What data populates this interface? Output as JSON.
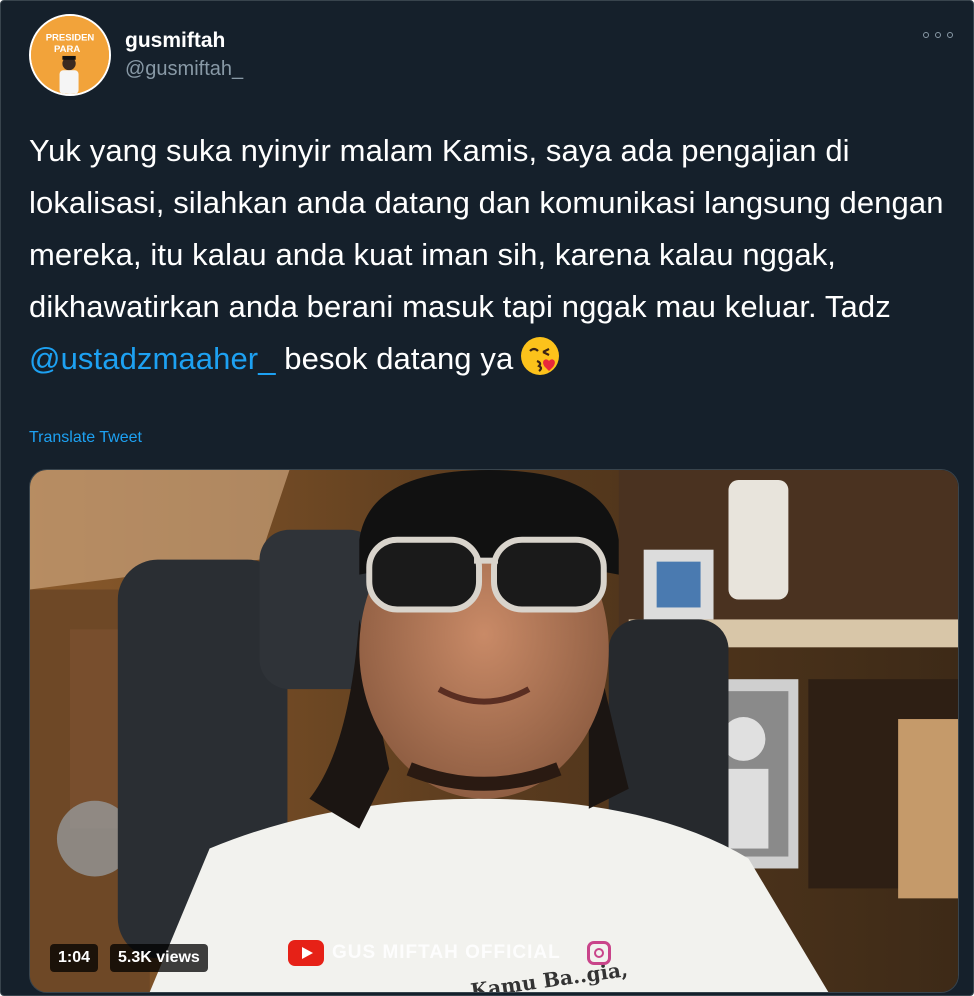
{
  "tweet": {
    "display_name": "gusmiftah",
    "handle": "@gusmiftah_",
    "text_before_mention": "Yuk yang suka nyinyir malam Kamis, saya ada pengajian di lokalisasi, silahkan anda datang dan komunikasi langsung dengan mereka, itu kalau anda kuat iman sih, karena kalau nggak, dikhawatirkan anda berani masuk tapi nggak mau keluar. Tadz ",
    "mention": "@ustadzmaaher_",
    "text_after_mention": " besok datang ya",
    "emoji": "face-blowing-a-kiss-emoji",
    "translate_label": "Translate Tweet"
  },
  "media": {
    "duration": "1:04",
    "views": "5.3K views",
    "channel_watermark": "GUS MIFTAH OFFICIAL",
    "instagram_watermark": "",
    "shirt_text": "Kamu Ba..gia,"
  },
  "avatar": {
    "text_top": "PRESIDEN",
    "text_bottom": "PARA"
  },
  "colors": {
    "background": "#15202b",
    "link": "#1da1f2",
    "secondary_text": "#8899a6",
    "primary_text": "#ffffff"
  }
}
